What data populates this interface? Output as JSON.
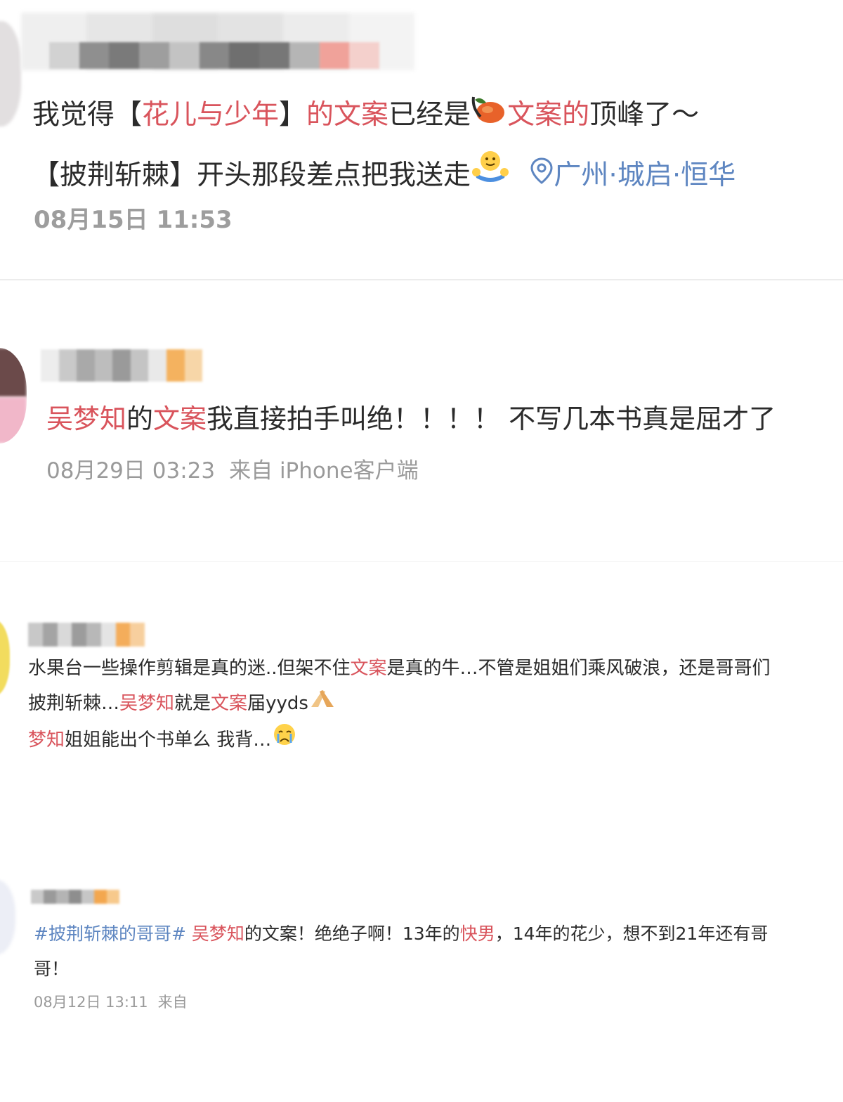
{
  "posts": [
    {
      "content_line1": {
        "t1": "我觉得【",
        "h1": "花儿与少年",
        "t2": "】",
        "h2": "的文案",
        "t3": "已经是",
        "emoji": "mango-emoji",
        "h3": "文案的",
        "t4": "顶峰了～"
      },
      "content_line2": {
        "t1": "【披荆斩棘】开头那段差点把我送走",
        "emoji": "hug-emoji",
        "location_icon": "location-pin-icon",
        "location": "广州·城启·恒华"
      },
      "timestamp": "08月15日 11:53"
    },
    {
      "content": {
        "h1": "吴梦知",
        "t1": "的",
        "h2": "文案",
        "t2": "我直接拍手叫绝！！！！ 不写几本书真是屈才了"
      },
      "timestamp": "08月29日 03:23",
      "source": "来自 iPhone客户端"
    },
    {
      "line1": {
        "t1": "水果台一些操作剪辑是真的迷..但架不住",
        "h1": "文案",
        "t2": "是真的牛…不管是姐姐们乘风破浪，还是哥哥们"
      },
      "line2": {
        "t1": "披荆斩棘…",
        "h1": "吴梦知",
        "t2": "就是",
        "h2": "文案",
        "t3": "届yyds",
        "emoji": "folded-hands-emoji"
      },
      "line3": {
        "h1": "梦知",
        "t1": "姐姐能出个书单么 我背…",
        "emoji": "crying-emoji"
      }
    },
    {
      "line1": {
        "tag": "#披荆斩棘的哥哥#",
        "sp": " ",
        "h1": "吴梦知",
        "t1": "的文案！绝绝子啊！13年的",
        "h2": "快男",
        "t2": "，14年的花少，想不到21年还有哥"
      },
      "line2": {
        "t1": "哥！"
      },
      "timestamp": "08月12日 13:11",
      "source": "来自"
    }
  ],
  "colors": {
    "highlight": "#d9545c",
    "topic": "#5e86c1",
    "meta": "#9a9a9a",
    "text": "#2b2b2b"
  }
}
